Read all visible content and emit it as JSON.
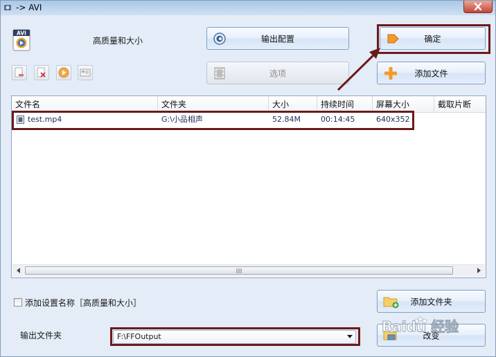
{
  "window": {
    "title": "-> AVI",
    "title_icon": "app-icon",
    "close_icon": "close-icon"
  },
  "profile": {
    "icon": "avi-file-icon",
    "icon_text": "AVI",
    "name": "高质量和大小"
  },
  "toolbar": {
    "output_config_label": "输出配置",
    "output_config_icon": "gear-icon",
    "options_label": "选项",
    "options_icon": "film-icon",
    "ok_label": "确定",
    "ok_icon": "arrow-right-icon",
    "add_file_label": "添加文件",
    "add_file_icon": "plus-icon",
    "small_tools": [
      "remove-icon",
      "delete-icon",
      "play-icon",
      "info-icon"
    ]
  },
  "file_list": {
    "columns": [
      "文件名",
      "文件夹",
      "大小",
      "持续时间",
      "屏幕大小",
      "截取片断"
    ],
    "rows": [
      {
        "name": "test.mp4",
        "folder": "G:\\小品相声",
        "size": "52.84M",
        "duration": "00:14:45",
        "screen": "640x352",
        "clip": ""
      }
    ]
  },
  "options": {
    "add_setting_label": "添加设置名称［高质量和大小］",
    "add_setting_checked": false,
    "add_folder_label": "添加文件夹",
    "add_folder_icon": "folder-add-icon",
    "output_folder_label": "输出文件夹",
    "output_folder_value": "F:\\FFOutput",
    "change_label": "改变",
    "change_icon": "folder-open-icon"
  },
  "watermark": {
    "text": "Baidu 经验",
    "logo": "baidu-paw-logo"
  },
  "colors": {
    "annotation": "#6b1a1a",
    "window_bg": "#e4ecf7"
  }
}
